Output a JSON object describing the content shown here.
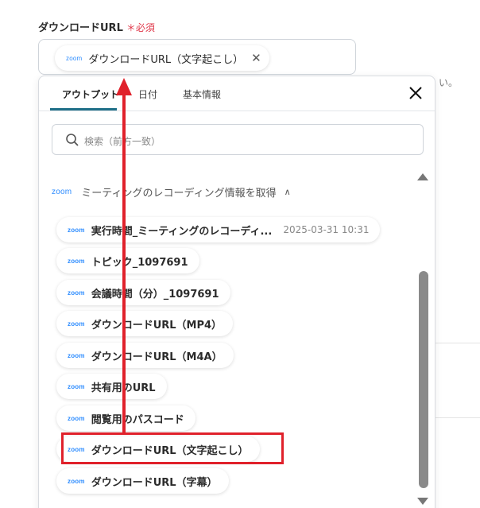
{
  "field": {
    "label": "ダウンロードURL",
    "required": "＊必須"
  },
  "selected": {
    "logo": "zoom",
    "label": "ダウンロードURL（文字起こし）"
  },
  "background": {
    "hint": "い。"
  },
  "tabs": [
    {
      "label": "アウトプット"
    },
    {
      "label": "日付"
    },
    {
      "label": "基本情報"
    }
  ],
  "search": {
    "placeholder": "検索（前方一致）"
  },
  "group": {
    "logo": "zoom",
    "title": "ミーティングのレコーディング情報を取得"
  },
  "options": [
    {
      "logo": "zoom",
      "label": "実行時間_ミーティングのレコーディ...",
      "value": "2025-03-31 10:31"
    },
    {
      "logo": "zoom",
      "label": "トピック_1097691"
    },
    {
      "logo": "zoom",
      "label": "会議時間（分）_1097691"
    },
    {
      "logo": "zoom",
      "label": "ダウンロードURL（MP4）"
    },
    {
      "logo": "zoom",
      "label": "ダウンロードURL（M4A）"
    },
    {
      "logo": "zoom",
      "label": "共有用のURL"
    },
    {
      "logo": "zoom",
      "label": "閲覧用のパスコード"
    },
    {
      "logo": "zoom",
      "label": "ダウンロードURL（文字起こし）"
    },
    {
      "logo": "zoom",
      "label": "ダウンロードURL（字幕）"
    }
  ],
  "colors": {
    "accent": "#1f6f88",
    "required": "#e0384a",
    "annotation": "#e0212b",
    "zoom": "#2d8cff"
  }
}
